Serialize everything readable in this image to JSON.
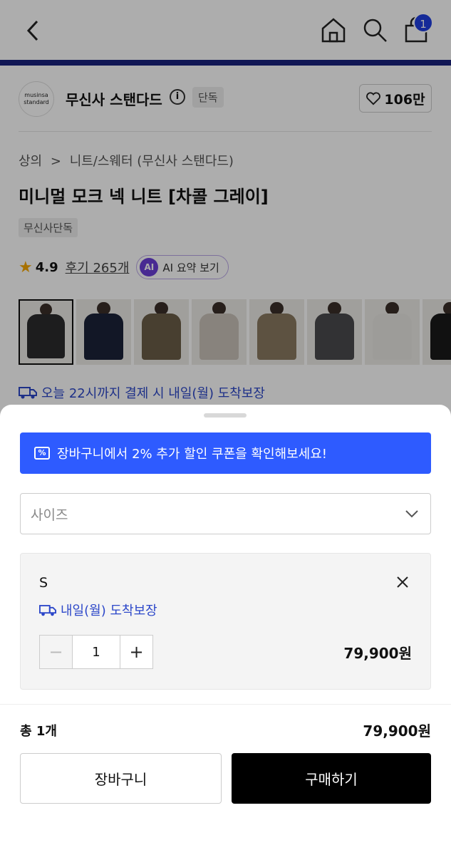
{
  "header": {
    "cart_count": "1"
  },
  "brand": {
    "logo_text_1": "musinsa",
    "logo_text_2": "standard",
    "name": "무신사 스탠다드",
    "info": "i",
    "exclusive_tag": "단독",
    "likes": "106만"
  },
  "product": {
    "breadcrumb_1": "상의",
    "breadcrumb_sep": ">",
    "breadcrumb_2": "니트/스웨터 (무신사 스탠다드)",
    "title": "미니멀 모크 넥 니트 [차콜 그레이]",
    "tag": "무신사단독",
    "rating": "4.9",
    "reviews": "후기 265개",
    "ai_icon": "AI",
    "ai_summary": "AI 요약 보기",
    "delivery": "오늘 22시까지 결제 시 내일(월) 도착보장",
    "thumbnail_colors": [
      "#2b2b2d",
      "#1b2238",
      "#6b5e48",
      "#c9c2b8",
      "#8a7a60",
      "#4a4b4d",
      "#e8e6e2",
      "#1a1a1a"
    ]
  },
  "sheet": {
    "coupon_icon": "%",
    "coupon_text": "장바구니에서 2% 추가 할인 쿠폰을 확인해보세요!",
    "size_placeholder": "사이즈",
    "selected_option": "S",
    "option_delivery": "내일(월) 도착보장",
    "quantity": "1",
    "minus": "−",
    "plus": "+",
    "option_price": "79,900원",
    "total_label": "총 1개",
    "total_price": "79,900원",
    "cart_button": "장바구니",
    "buy_button": "구매하기"
  },
  "colors": {
    "accent_blue": "#2e5bff",
    "delivery_blue": "#2c47c9",
    "header_line": "#1a237e",
    "star": "#f6a700"
  }
}
